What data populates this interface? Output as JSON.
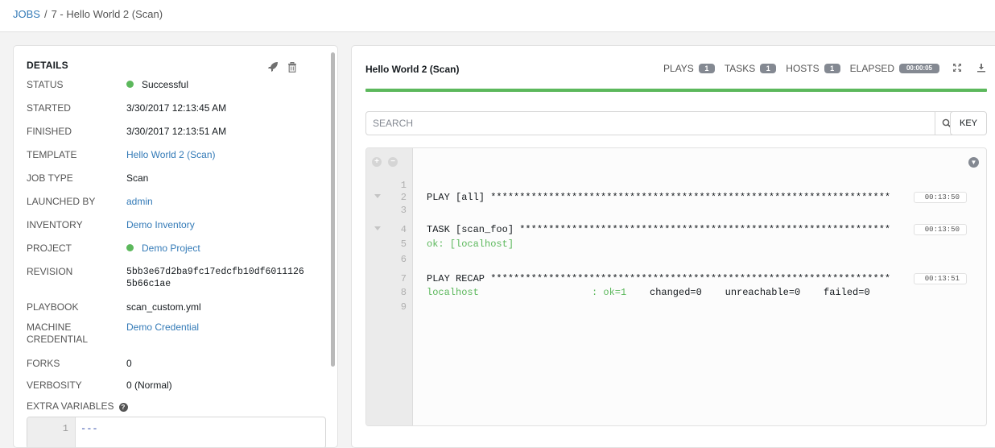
{
  "breadcrumb": {
    "root": "JOBS",
    "separator": "/",
    "current": "7 - Hello World 2 (Scan)"
  },
  "details": {
    "title": "DETAILS",
    "rows": {
      "status": {
        "label": "STATUS",
        "value": "Successful"
      },
      "started": {
        "label": "STARTED",
        "value": "3/30/2017 12:13:45 AM"
      },
      "finished": {
        "label": "FINISHED",
        "value": "3/30/2017 12:13:51 AM"
      },
      "template": {
        "label": "TEMPLATE",
        "value": "Hello World 2 (Scan)"
      },
      "job_type": {
        "label": "JOB TYPE",
        "value": "Scan"
      },
      "launched_by": {
        "label": "LAUNCHED BY",
        "value": "admin"
      },
      "inventory": {
        "label": "INVENTORY",
        "value": "Demo Inventory"
      },
      "project": {
        "label": "PROJECT",
        "value": "Demo Project"
      },
      "revision": {
        "label": "REVISION",
        "value_line1": "5bb3e67d2ba9fc17edcfb10df6011126",
        "value_line2": "5b66c1ae"
      },
      "playbook": {
        "label": "PLAYBOOK",
        "value": "scan_custom.yml"
      },
      "machine_credential": {
        "label_line1": "MACHINE",
        "label_line2": "CREDENTIAL",
        "value": "Demo Credential"
      },
      "forks": {
        "label": "FORKS",
        "value": "0"
      },
      "verbosity": {
        "label": "VERBOSITY",
        "value": "0 (Normal)"
      }
    },
    "extra_variables": {
      "label": "EXTRA VARIABLES",
      "line_number": "1",
      "code": "---"
    }
  },
  "job": {
    "title": "Hello World 2 (Scan)",
    "stats": {
      "plays_label": "PLAYS",
      "plays": "1",
      "tasks_label": "TASKS",
      "tasks": "1",
      "hosts_label": "HOSTS",
      "hosts": "1",
      "elapsed_label": "ELAPSED",
      "elapsed": "00:00:05"
    },
    "search_placeholder": "SEARCH",
    "key_label": "KEY",
    "status_color": "#5cb85c"
  },
  "output": {
    "lines": [
      {
        "num": "1",
        "text": "",
        "time": ""
      },
      {
        "num": "2",
        "text": "PLAY [all] *********************************************************************",
        "time": "00:13:50"
      },
      {
        "num": "3",
        "text": "",
        "time": ""
      },
      {
        "num": "4",
        "text": "TASK [scan_foo] ****************************************************************",
        "time": "00:13:50"
      },
      {
        "num": "5",
        "text": "ok: [localhost]",
        "time": ""
      },
      {
        "num": "6",
        "text": "",
        "time": ""
      },
      {
        "num": "7",
        "text": "PLAY RECAP *********************************************************************",
        "time": "00:13:51"
      },
      {
        "num": "8",
        "host": "localhost",
        "ok": ": ok=1",
        "rest": "changed=0    unreachable=0    failed=0",
        "time": ""
      },
      {
        "num": "9",
        "text": "",
        "time": ""
      }
    ]
  },
  "icons": {
    "rocket": "rocket-icon",
    "trash": "trash-icon",
    "help": "help-icon",
    "expand": "expand-icon",
    "download": "download-icon",
    "search": "search-icon",
    "plus": "plus-icon",
    "minus": "minus-icon",
    "scroll_down": "arrow-down-circle-icon",
    "caret": "caret-down-icon"
  }
}
